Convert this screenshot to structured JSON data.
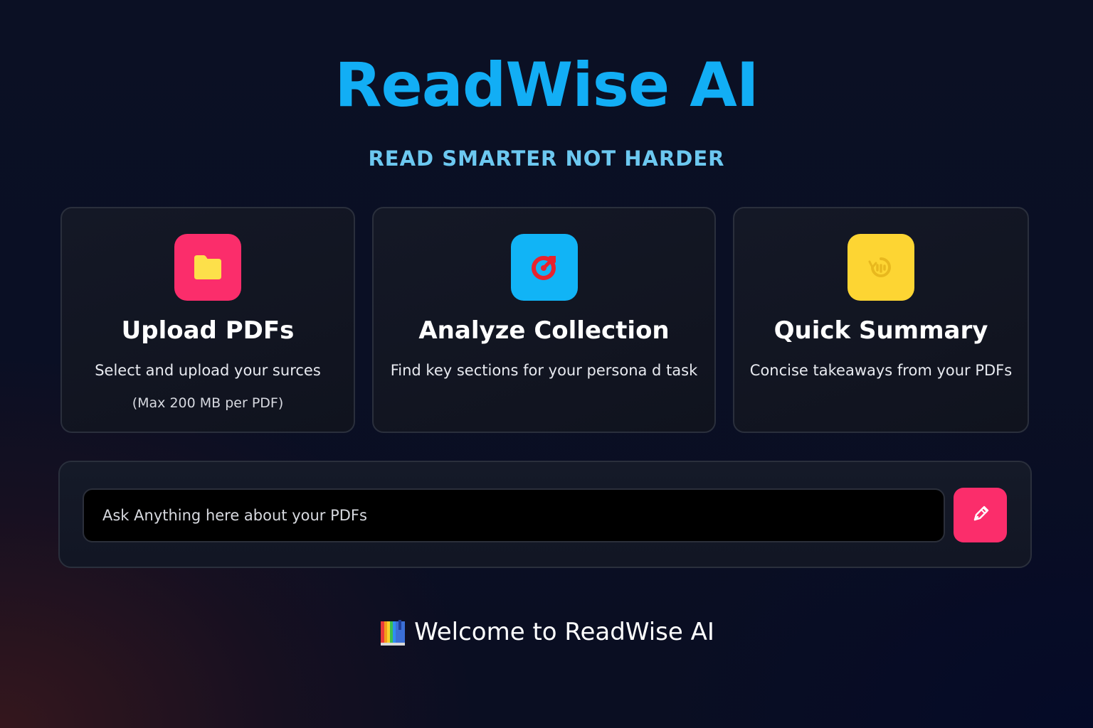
{
  "header": {
    "title": "ReadWise AI",
    "tagline": "READ SMARTER NOT HARDER"
  },
  "features": [
    {
      "icon": "folder-icon",
      "title": "Upload PDFs",
      "description": "Select and upload your surces",
      "note": "(Max 200 MB per PDF)"
    },
    {
      "icon": "target-icon",
      "title": "Analyze Collection",
      "description": "Find key sections for your persona d task"
    },
    {
      "icon": "summary-icon",
      "title": "Quick Summary",
      "description": "Concise takeaways from your PDFs"
    }
  ],
  "ask": {
    "placeholder": "Ask Anything here about your PDFs",
    "value": "",
    "send_icon": "pen-icon"
  },
  "welcome": {
    "icon": "book-icon",
    "text": "Welcome to ReadWise AI"
  },
  "colors": {
    "brand": "#12aef5",
    "tagline": "#6cc8f0",
    "pink": "#fb2d6b",
    "blue": "#11b4f6",
    "yellow": "#fdd533"
  }
}
